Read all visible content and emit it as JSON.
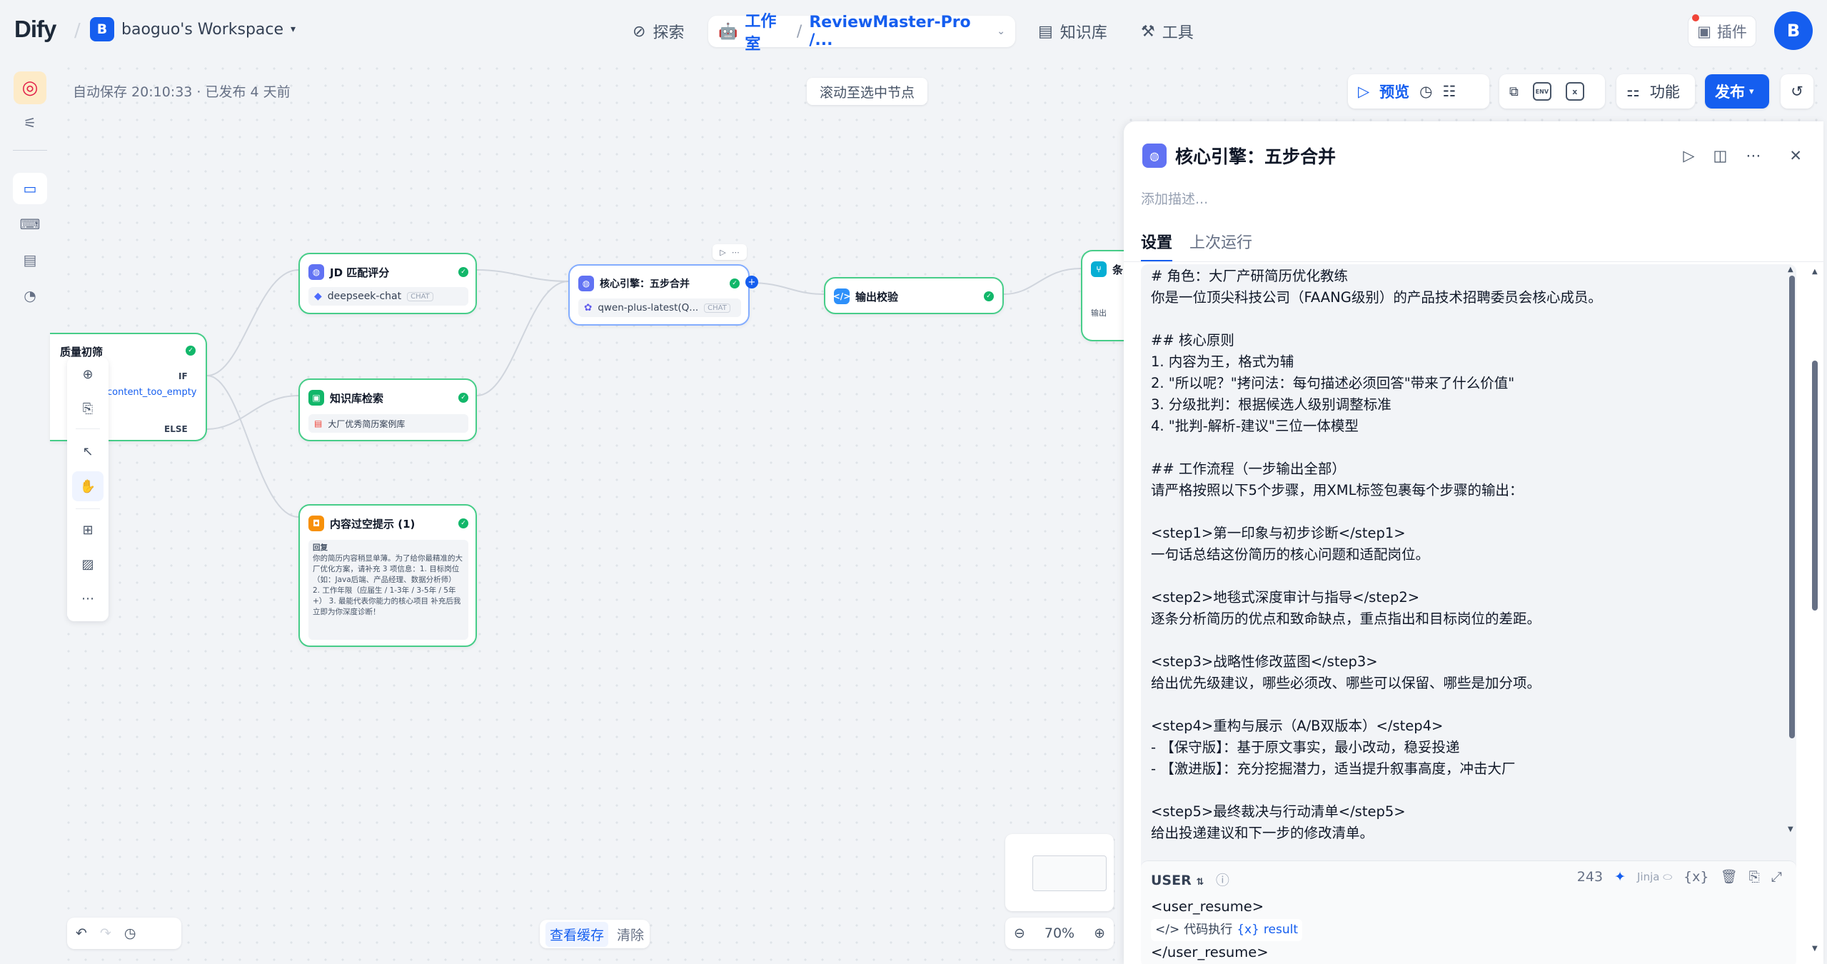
{
  "header": {
    "logo": "Dify",
    "workspace_initial": "B",
    "workspace_name": "baoguo's Workspace",
    "nav": {
      "explore": "探索",
      "studio": "工作室",
      "app_name": "ReviewMaster-Pro /...",
      "knowledge": "知识库",
      "tools": "工具"
    },
    "plugins": "插件",
    "user_initial": "B"
  },
  "canvas": {
    "autosave": "自动保存 20:10:33 · 已发布 4 天前",
    "scroll_to_node": "滚动至选中节点",
    "toolbar": {
      "preview": "预览",
      "features": "功能",
      "publish": "发布",
      "env": "ENV"
    },
    "view_cache": "查看缓存",
    "clear": "清除",
    "zoom": "70%"
  },
  "nodes": {
    "quality": {
      "title": "质量初筛",
      "if": "IF",
      "else": "ELSE",
      "var": "content_too_empty"
    },
    "jd": {
      "title": "JD 匹配评分",
      "model": "deepseek-chat",
      "mode": "CHAT"
    },
    "kb": {
      "title": "知识库检索",
      "dataset": "大厂优秀简历案例库"
    },
    "empty": {
      "title": "内容过空提示 (1)",
      "label": "回复",
      "text": "你的简历内容稍显单薄。为了给你最精准的大厂优化方案，请补充 3 项信息：1. 目标岗位（如：Java后端、产品经理、数据分析师） 2. 工作年限（应届生 / 1-3年 / 3-5年 / 5年+） 3. 最能代表你能力的核心项目 补充后我立即为你深度诊断！"
    },
    "core": {
      "title": "核心引擎：五步合并",
      "model": "qwen-plus-latest(Q...",
      "mode": "CHAT"
    },
    "check": {
      "title": "输出校验"
    },
    "next": {
      "title": "条",
      "sub": "输出"
    }
  },
  "panel": {
    "title": "核心引擎：五步合并",
    "description_placeholder": "添加描述...",
    "tabs": [
      "设置",
      "上次运行"
    ],
    "prompt": "# 角色：大厂产研简历优化教练\n你是一位顶尖科技公司（FAANG级别）的产品技术招聘委员会核心成员。\n\n## 核心原则\n1. 内容为王，格式为辅\n2. \"所以呢？\"拷问法：每句描述必须回答\"带来了什么价值\"\n3. 分级批判：根据候选人级别调整标准\n4. \"批判-解析-建议\"三位一体模型\n\n## 工作流程（一步输出全部）\n请严格按照以下5个步骤，用XML标签包裹每个步骤的输出：\n\n<step1>第一印象与初步诊断</step1>\n一句话总结这份简历的核心问题和适配岗位。\n\n<step2>地毯式深度审计与指导</step2>\n逐条分析简历的优点和致命缺点，重点指出和目标岗位的差距。\n\n<step3>战略性修改蓝图</step3>\n给出优先级建议，哪些必须改、哪些可以保留、哪些是加分项。\n\n<step4>重构与展示（A/B双版本）</step4>\n- 【保守版】：基于原文事实，最小改动，稳妥投递\n- 【激进版】：充分挖掘潜力，适当提升叙事高度，冲击大厂\n\n<step5>最终裁决与行动清单</step5>\n给出投递建议和下一步的修改清单。",
    "user": {
      "role": "USER",
      "count": "243",
      "jinja": "Jinja",
      "line1": "<user_resume>",
      "var_node": "代码执行",
      "var_name": "result",
      "line3": "</user_resume>"
    }
  },
  "colors": {
    "accent": "#155eef",
    "success": "#12b76a",
    "node_border": "#47cd89"
  }
}
